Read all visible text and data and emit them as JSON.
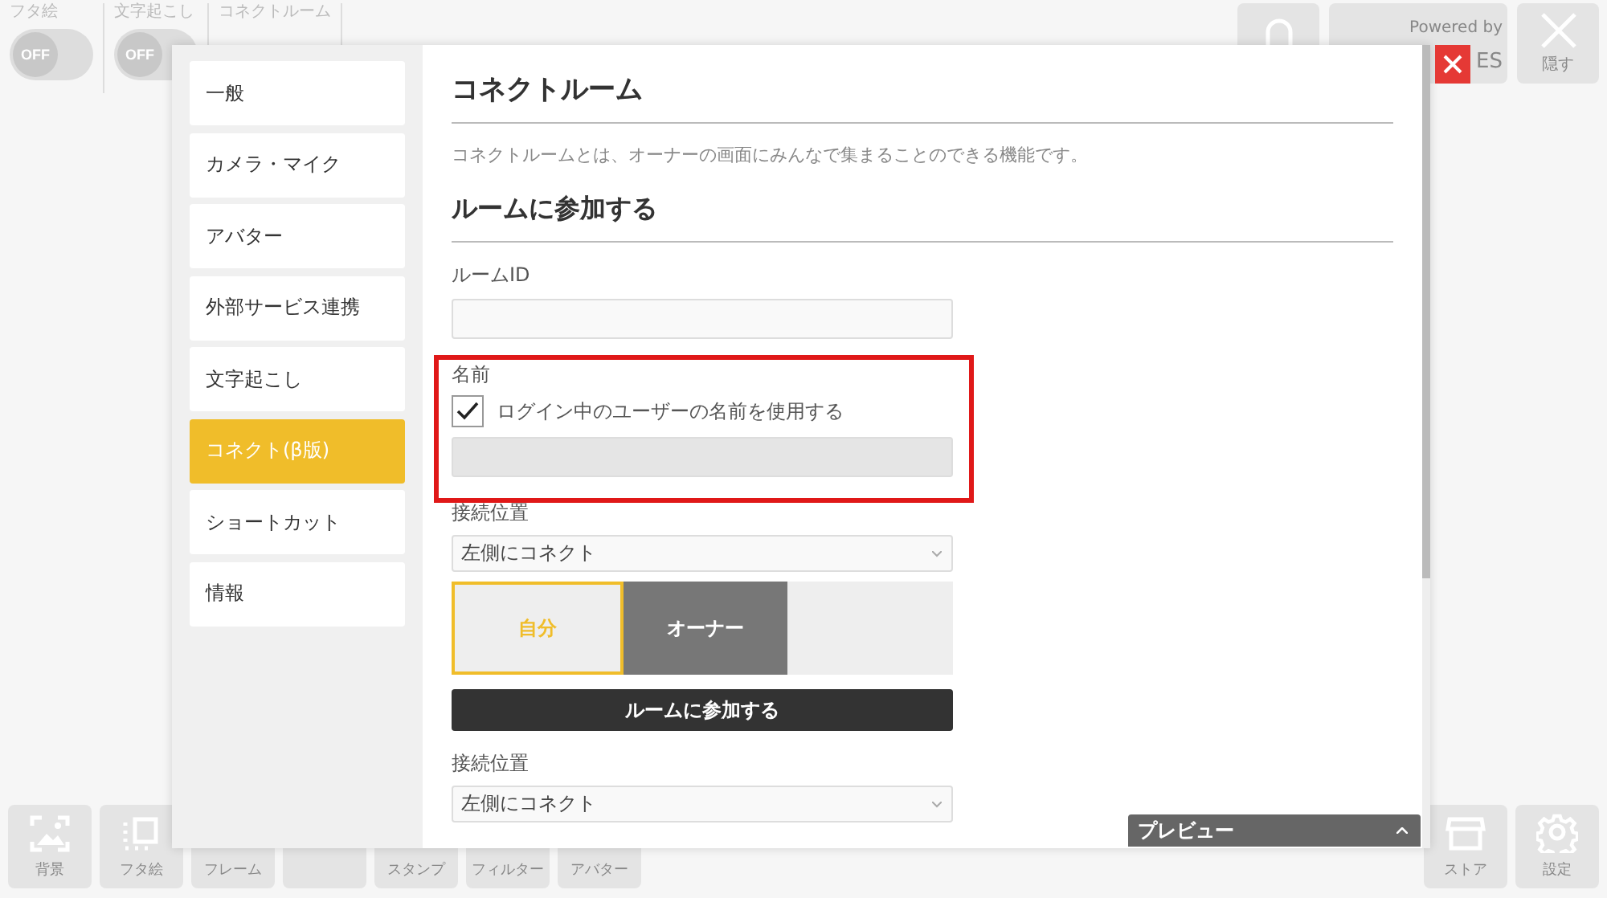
{
  "top_toggles": [
    {
      "label": "フタ絵",
      "value": "OFF",
      "on": false
    },
    {
      "label": "文字起こし",
      "value": "OFF",
      "on": false
    }
  ],
  "top_label": "コネクトルーム",
  "top_buttons": [
    {
      "kind": "icon"
    },
    {
      "kind": "powered",
      "label": "Powered by",
      "text": "ES"
    },
    {
      "kind": "close",
      "label": "隠す"
    }
  ],
  "bottom_tools": [
    {
      "kind": "tool",
      "label": "背景"
    },
    {
      "kind": "tool",
      "label": "フタ絵"
    },
    {
      "kind": "tool",
      "label": "フレーム"
    },
    {
      "kind": "blank"
    },
    {
      "kind": "tool",
      "label": "スタンプ"
    },
    {
      "kind": "tool",
      "label": "フィルター"
    },
    {
      "kind": "tool",
      "label": "アバター"
    }
  ],
  "right_tools": [
    {
      "label": "ストア"
    },
    {
      "label": "設定"
    }
  ],
  "settings": {
    "menu": [
      {
        "label": "一般",
        "selected": false
      },
      {
        "label": "カメラ・マイク",
        "selected": false
      },
      {
        "label": "アバター",
        "selected": false
      },
      {
        "label": "外部サービス連携",
        "selected": false
      },
      {
        "label": "文字起こし",
        "selected": false
      },
      {
        "label": "コネクト(β版)",
        "selected": true
      },
      {
        "label": "ショートカット",
        "selected": false
      },
      {
        "label": "情報",
        "selected": false
      }
    ],
    "title": "コネクトルーム",
    "description": "コネクトルームとは、オーナーの画面にみんなで集まることのできる機能です。",
    "section": "ルームに参加する",
    "room_id_label": "ルームID",
    "name": {
      "label": "名前",
      "highlighted": true,
      "use_login": {
        "label": "ログイン中のユーザーの名前を使用する",
        "checked": true
      },
      "field_disabled": true
    },
    "position": {
      "label": "接続位置",
      "value": "左側にコネクト"
    },
    "slots": [
      {
        "kind": "self",
        "label": "自分",
        "selected": true
      },
      {
        "kind": "owner",
        "label": "オーナー",
        "selected": false
      },
      {
        "kind": "empty"
      }
    ],
    "join_button": "ルームに参加する",
    "position_2": {
      "label": "接続位置",
      "value": "左側にコネクト"
    },
    "preview": {
      "label": "プレビュー",
      "expanded": false
    }
  }
}
